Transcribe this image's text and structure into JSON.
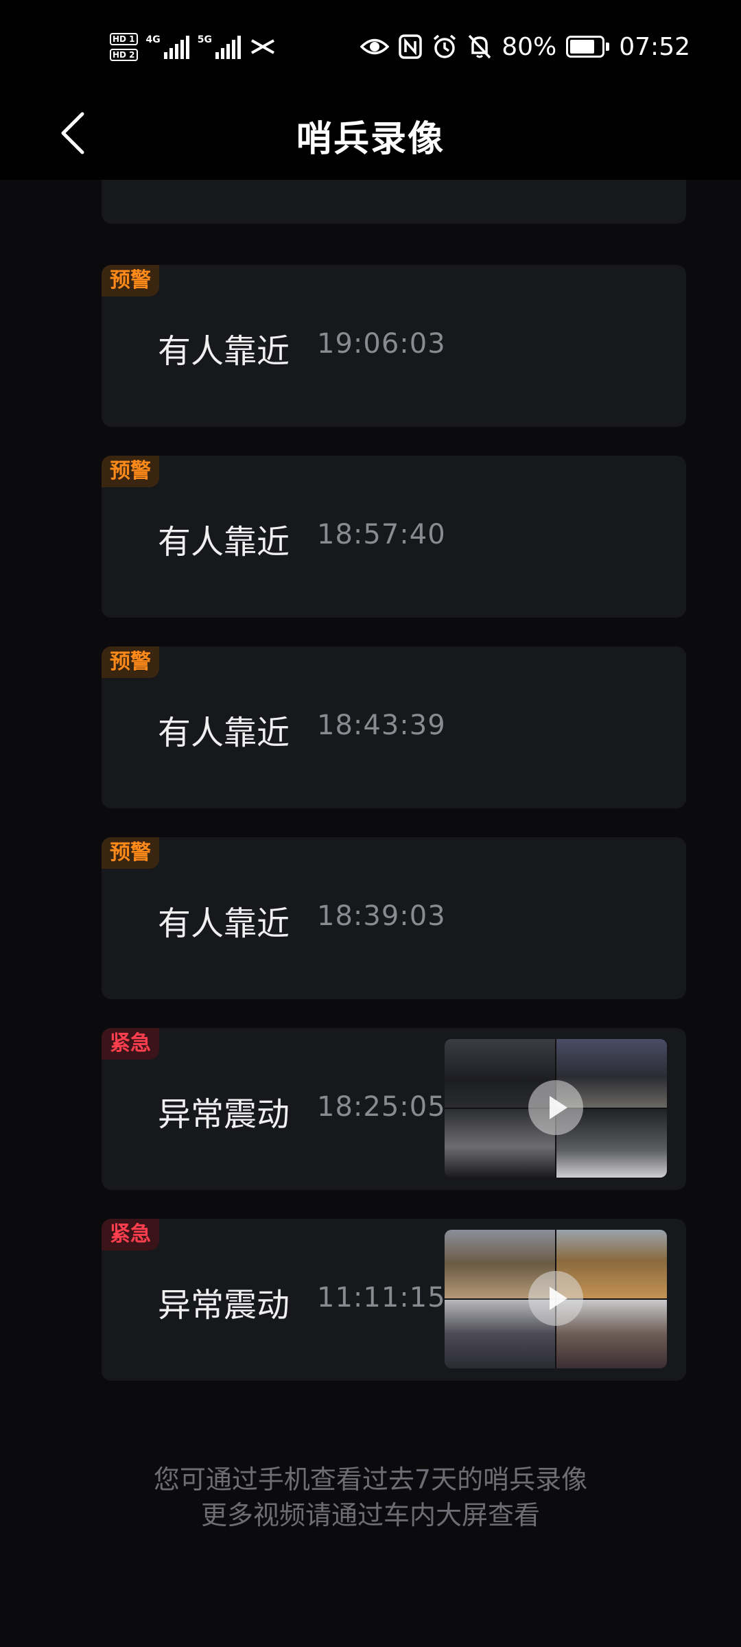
{
  "status_bar": {
    "sim1": "HD 1",
    "sim2": "HD 2",
    "net1": "4G",
    "net2": "5G",
    "battery_percent": "80%",
    "battery_level": 0.8,
    "time": "07:52",
    "icons": [
      "eye-icon",
      "nfc-icon",
      "alarm-icon",
      "mute-icon"
    ]
  },
  "header": {
    "title": "哨兵录像",
    "back_icon": "chevron-left-icon"
  },
  "records": [
    {
      "tag": "预警",
      "level": "warn",
      "event": "有人靠近",
      "time": "19:06:03",
      "has_video": false
    },
    {
      "tag": "预警",
      "level": "warn",
      "event": "有人靠近",
      "time": "18:57:40",
      "has_video": false
    },
    {
      "tag": "预警",
      "level": "warn",
      "event": "有人靠近",
      "time": "18:43:39",
      "has_video": false
    },
    {
      "tag": "预警",
      "level": "warn",
      "event": "有人靠近",
      "time": "18:39:03",
      "has_video": false
    },
    {
      "tag": "紧急",
      "level": "urgent",
      "event": "异常震动",
      "time": "18:25:05",
      "has_video": true
    },
    {
      "tag": "紧急",
      "level": "urgent",
      "event": "异常震动",
      "time": "11:11:15",
      "has_video": true
    }
  ],
  "footer": {
    "line1": "您可通过手机查看过去7天的哨兵录像",
    "line2": "更多视频请通过车内大屏查看"
  },
  "colors": {
    "warn": "#ff8a1a",
    "urgent": "#ff3e4e",
    "card": "#17181c"
  }
}
